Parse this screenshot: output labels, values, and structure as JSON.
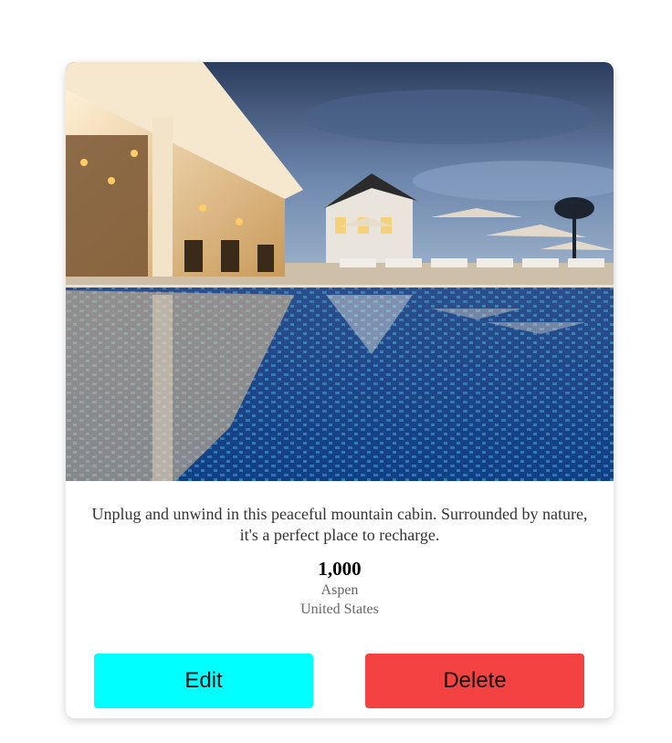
{
  "listing": {
    "image_subject": "resort-pool-photo",
    "description": "Unplug and unwind in this peaceful mountain cabin. Surrounded by nature, it's a perfect place to recharge.",
    "price": "1,000",
    "city": "Aspen",
    "country": "United States"
  },
  "actions": {
    "edit_label": "Edit",
    "delete_label": "Delete"
  },
  "colors": {
    "edit_button": "#00ffff",
    "delete_button": "#f44242",
    "card_background": "#ffffff"
  }
}
